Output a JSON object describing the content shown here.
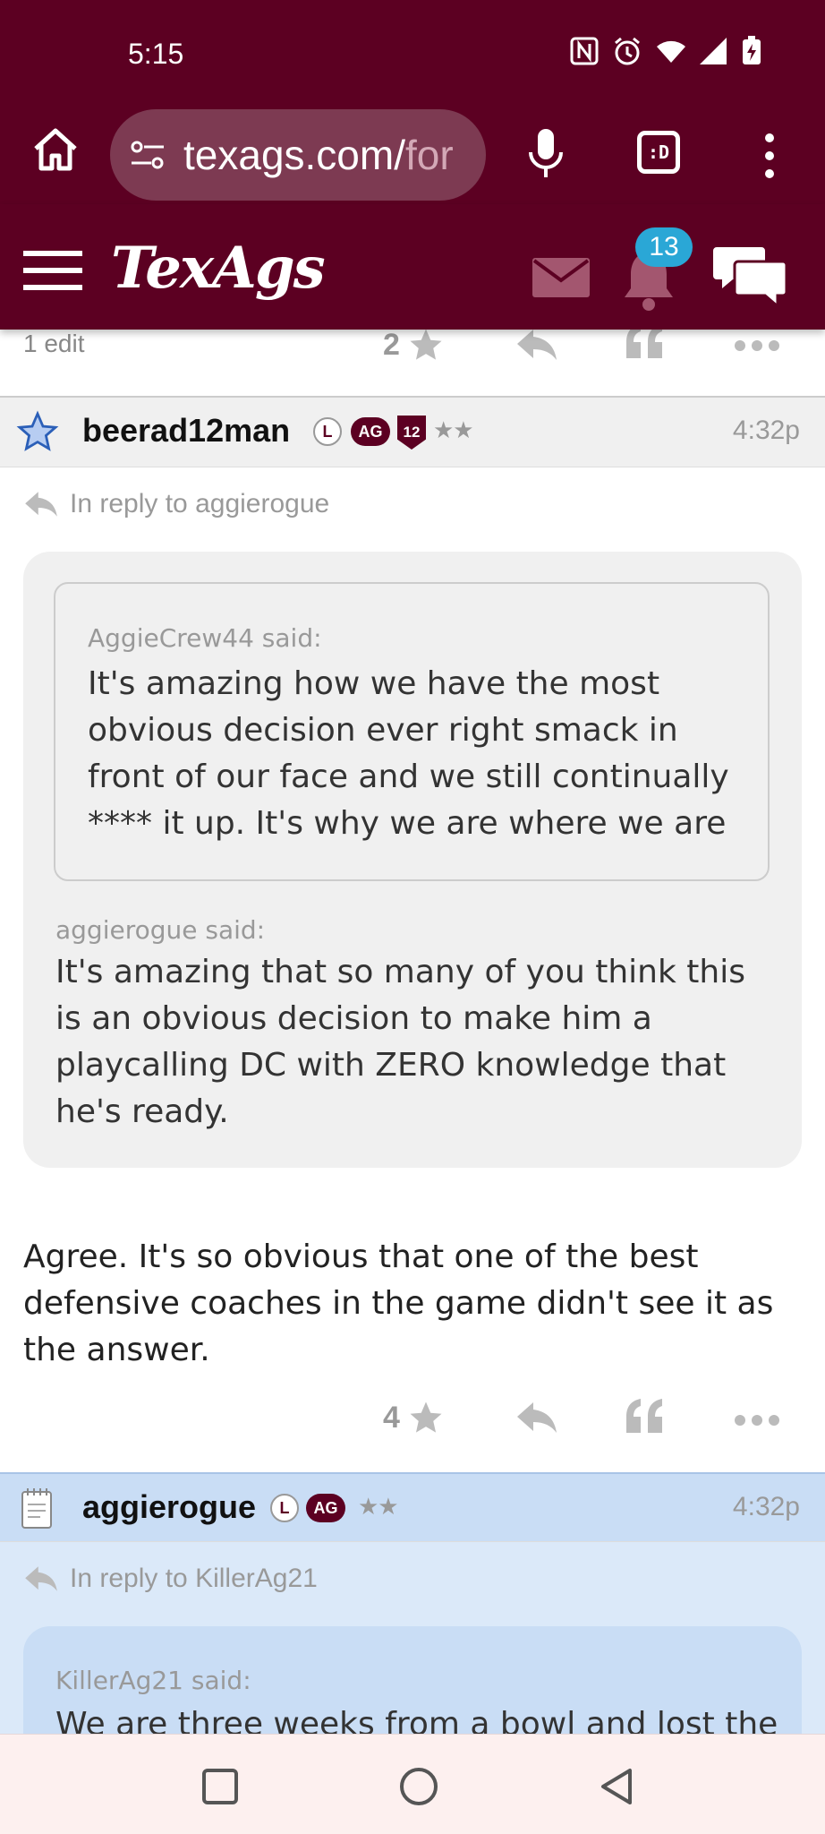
{
  "status_bar": {
    "time": "5:15",
    "icons": [
      "nfc-icon",
      "alarm-icon",
      "wifi-icon",
      "signal-icon",
      "battery-charging-icon"
    ]
  },
  "browser": {
    "url_main": "texags.com/",
    "url_rest": "for",
    "tab_switcher_label": ":D"
  },
  "site": {
    "logo": "TexAgs",
    "notification_count": "13",
    "colors": {
      "maroon": "#5c0022",
      "badge_blue": "#2aa7d6",
      "highlight_blue": "#d8e8f8"
    }
  },
  "prev_post": {
    "edit_note": "1 edit",
    "rating": "2"
  },
  "posts": [
    {
      "username": "beerad12man",
      "badges": [
        "L",
        "AG",
        "12"
      ],
      "stars": "★★",
      "time": "4:32p",
      "reply_to": "In reply to aggierogue",
      "inner_quote": {
        "said": "AggieCrew44 said:",
        "text": "It's amazing how we have the most obvious decision ever right smack in front of our face and we still continually **** it up. It's why we are where we are"
      },
      "outer_quote": {
        "said": "aggierogue said:",
        "text": "It's amazing that so many of you think this is an obvious decision to make him a playcalling DC with ZERO knowledge that he's ready."
      },
      "body": "Agree. It's so obvious that one of the best defensive coaches in the game didn't see it as the answer.",
      "rating": "4"
    },
    {
      "username": "aggierogue",
      "badges": [
        "L",
        "AG"
      ],
      "stars": "★★",
      "time": "4:32p",
      "reply_to": "In reply to KillerAg21",
      "outer_quote": {
        "said": "KillerAg21 said:",
        "text": "We are three weeks from a bowl and lost the"
      }
    }
  ]
}
